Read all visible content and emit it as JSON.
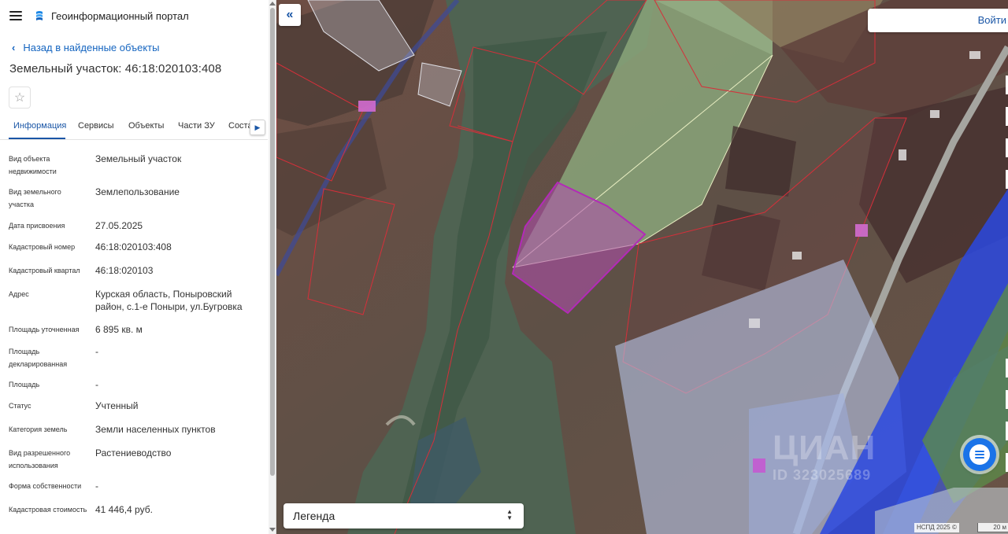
{
  "app": {
    "title": "Геоинформационный портал"
  },
  "nav": {
    "back_label": "Назад в найденные объекты"
  },
  "object": {
    "title": "Земельный участок: 46:18:020103:408"
  },
  "tabs": [
    {
      "label": "Информация",
      "active": true
    },
    {
      "label": "Сервисы"
    },
    {
      "label": "Объекты"
    },
    {
      "label": "Части ЗУ"
    },
    {
      "label": "Состав"
    }
  ],
  "info": [
    {
      "label": "Вид объекта недвижимости",
      "value": "Земельный участок"
    },
    {
      "label": "Вид земельного участка",
      "value": "Землепользование"
    },
    {
      "label": "Дата присвоения",
      "value": "27.05.2025"
    },
    {
      "label": "Кадастровый номер",
      "value": "46:18:020103:408"
    },
    {
      "label": "Кадастровый квартал",
      "value": "46:18:020103"
    },
    {
      "label": "Адрес",
      "value": "Курская область, Поныровский район, с.1-е Поныри, ул.Бугровка"
    },
    {
      "label": "Площадь уточненная",
      "value": "6 895 кв. м"
    },
    {
      "label": "Площадь декларированная",
      "value": "-"
    },
    {
      "label": "Площадь",
      "value": "-"
    },
    {
      "label": "Статус",
      "value": "Учтенный"
    },
    {
      "label": "Категория земель",
      "value": "Земли населенных пунктов"
    },
    {
      "label": "Вид разрешенного использования",
      "value": "Растениеводство"
    },
    {
      "label": "Форма собственности",
      "value": "-"
    },
    {
      "label": "Кадастровая стоимость",
      "value": "41 446,4 руб."
    }
  ],
  "map": {
    "login_label": "Войти",
    "legend_label": "Легенда",
    "attribution": "НСПД 2025 ©",
    "scale_label": "20 м",
    "watermark_text": "ЦИАН",
    "watermark_id": "ID 323025689"
  },
  "colors": {
    "accent": "#1a56a6",
    "selected_parcel": "#b32ab8",
    "parcel_border": "#d62f3a"
  },
  "icons": {
    "menu": "hamburger-icon",
    "logo": "portal-logo-icon",
    "back": "chevron-left-icon",
    "favorite": "star-icon",
    "tabs_next": "chevron-right-icon",
    "collapse": "double-chevron-left-icon",
    "legend_toggle": "up-down-arrows-icon",
    "chat": "chat-icon"
  }
}
